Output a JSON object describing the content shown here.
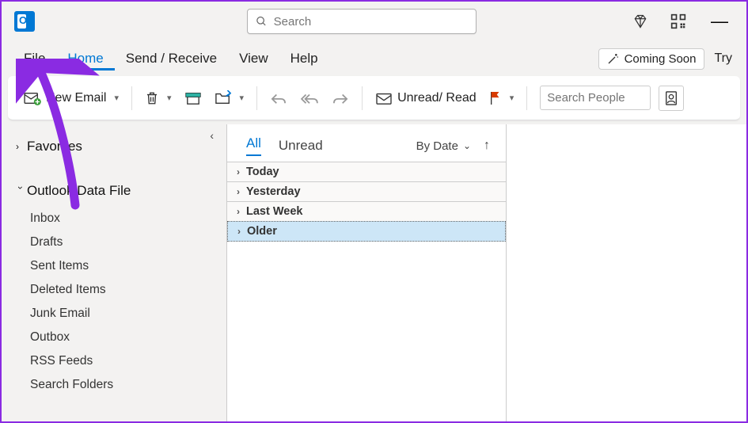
{
  "titlebar": {
    "search_placeholder": "Search",
    "minimize": "—"
  },
  "menu": {
    "items": [
      "File",
      "Home",
      "Send / Receive",
      "View",
      "Help"
    ],
    "active": "Home",
    "coming_soon": "Coming Soon",
    "try_label": "Try"
  },
  "toolbar": {
    "new_email": "New Email",
    "unread_read": "Unread/ Read",
    "search_people": "Search People"
  },
  "nav": {
    "favorites": "Favorites",
    "data_file": "Outlook Data File",
    "folders": [
      "Inbox",
      "Drafts",
      "Sent Items",
      "Deleted Items",
      "Junk Email",
      "Outbox",
      "RSS Feeds",
      "Search Folders"
    ]
  },
  "maillist": {
    "tabs": {
      "all": "All",
      "unread": "Unread"
    },
    "sort_label": "By Date",
    "groups": [
      "Today",
      "Yesterday",
      "Last Week",
      "Older"
    ],
    "selected_group": "Older"
  },
  "colors": {
    "accent": "#0078d4",
    "annotation": "#7b1fa2",
    "flag": "#d83b01"
  }
}
